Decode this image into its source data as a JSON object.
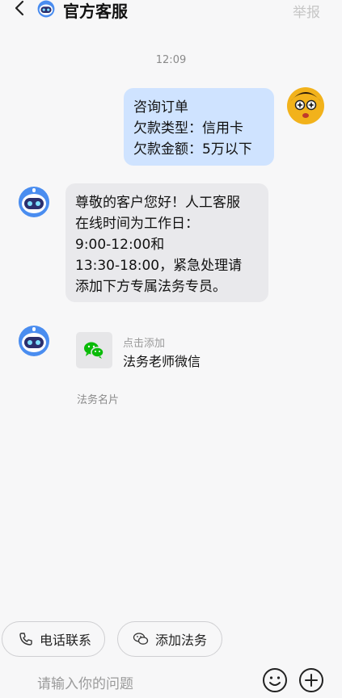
{
  "header": {
    "title": "官方客服",
    "report_label": "举报"
  },
  "conversation": {
    "timestamp": "12:09",
    "user_message": [
      "咨询订单",
      "欠款类型：信用卡",
      "欠款金额：5万以下"
    ],
    "bot_message": [
      "尊敬的客户您好！人工客服",
      "在线时间为工作日：",
      "9:00-12:00和",
      "13:30-18:00，紧急处理请",
      "添加下方专属法务专员。"
    ],
    "card": {
      "hint": "点击添加",
      "title": "法务老师微信",
      "tag": "法务名片"
    }
  },
  "quick_actions": [
    {
      "label": "电话联系",
      "icon": "phone-icon"
    },
    {
      "label": "添加法务",
      "icon": "wechat-outline-icon"
    }
  ],
  "input": {
    "placeholder": "请输入你的问题"
  },
  "colors": {
    "user_bubble": "#cfe3ff",
    "bot_bubble": "#e9e9ec",
    "background": "#f7f7f8",
    "wechat_green": "#09bb07"
  }
}
